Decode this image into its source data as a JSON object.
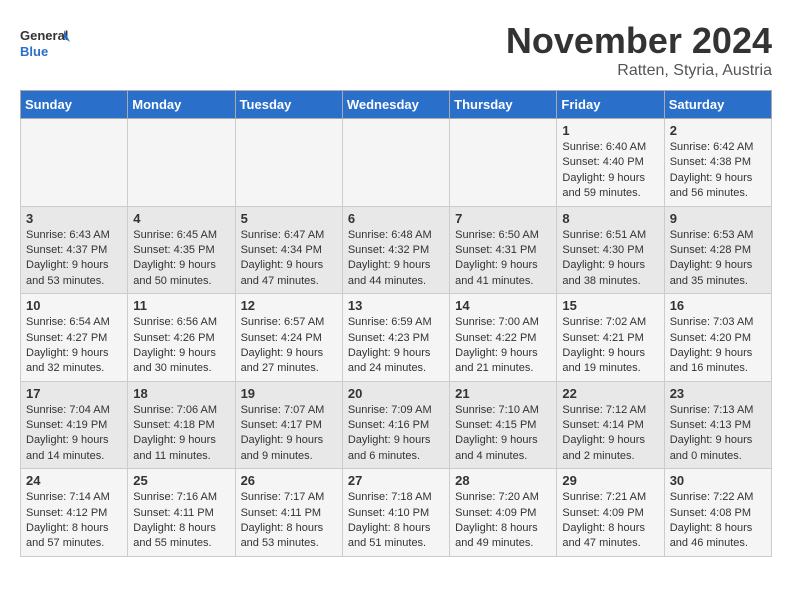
{
  "header": {
    "logo_line1": "General",
    "logo_line2": "Blue",
    "month": "November 2024",
    "location": "Ratten, Styria, Austria"
  },
  "weekdays": [
    "Sunday",
    "Monday",
    "Tuesday",
    "Wednesday",
    "Thursday",
    "Friday",
    "Saturday"
  ],
  "weeks": [
    [
      {
        "day": "",
        "info": ""
      },
      {
        "day": "",
        "info": ""
      },
      {
        "day": "",
        "info": ""
      },
      {
        "day": "",
        "info": ""
      },
      {
        "day": "",
        "info": ""
      },
      {
        "day": "1",
        "info": "Sunrise: 6:40 AM\nSunset: 4:40 PM\nDaylight: 9 hours and 59 minutes."
      },
      {
        "day": "2",
        "info": "Sunrise: 6:42 AM\nSunset: 4:38 PM\nDaylight: 9 hours and 56 minutes."
      }
    ],
    [
      {
        "day": "3",
        "info": "Sunrise: 6:43 AM\nSunset: 4:37 PM\nDaylight: 9 hours and 53 minutes."
      },
      {
        "day": "4",
        "info": "Sunrise: 6:45 AM\nSunset: 4:35 PM\nDaylight: 9 hours and 50 minutes."
      },
      {
        "day": "5",
        "info": "Sunrise: 6:47 AM\nSunset: 4:34 PM\nDaylight: 9 hours and 47 minutes."
      },
      {
        "day": "6",
        "info": "Sunrise: 6:48 AM\nSunset: 4:32 PM\nDaylight: 9 hours and 44 minutes."
      },
      {
        "day": "7",
        "info": "Sunrise: 6:50 AM\nSunset: 4:31 PM\nDaylight: 9 hours and 41 minutes."
      },
      {
        "day": "8",
        "info": "Sunrise: 6:51 AM\nSunset: 4:30 PM\nDaylight: 9 hours and 38 minutes."
      },
      {
        "day": "9",
        "info": "Sunrise: 6:53 AM\nSunset: 4:28 PM\nDaylight: 9 hours and 35 minutes."
      }
    ],
    [
      {
        "day": "10",
        "info": "Sunrise: 6:54 AM\nSunset: 4:27 PM\nDaylight: 9 hours and 32 minutes."
      },
      {
        "day": "11",
        "info": "Sunrise: 6:56 AM\nSunset: 4:26 PM\nDaylight: 9 hours and 30 minutes."
      },
      {
        "day": "12",
        "info": "Sunrise: 6:57 AM\nSunset: 4:24 PM\nDaylight: 9 hours and 27 minutes."
      },
      {
        "day": "13",
        "info": "Sunrise: 6:59 AM\nSunset: 4:23 PM\nDaylight: 9 hours and 24 minutes."
      },
      {
        "day": "14",
        "info": "Sunrise: 7:00 AM\nSunset: 4:22 PM\nDaylight: 9 hours and 21 minutes."
      },
      {
        "day": "15",
        "info": "Sunrise: 7:02 AM\nSunset: 4:21 PM\nDaylight: 9 hours and 19 minutes."
      },
      {
        "day": "16",
        "info": "Sunrise: 7:03 AM\nSunset: 4:20 PM\nDaylight: 9 hours and 16 minutes."
      }
    ],
    [
      {
        "day": "17",
        "info": "Sunrise: 7:04 AM\nSunset: 4:19 PM\nDaylight: 9 hours and 14 minutes."
      },
      {
        "day": "18",
        "info": "Sunrise: 7:06 AM\nSunset: 4:18 PM\nDaylight: 9 hours and 11 minutes."
      },
      {
        "day": "19",
        "info": "Sunrise: 7:07 AM\nSunset: 4:17 PM\nDaylight: 9 hours and 9 minutes."
      },
      {
        "day": "20",
        "info": "Sunrise: 7:09 AM\nSunset: 4:16 PM\nDaylight: 9 hours and 6 minutes."
      },
      {
        "day": "21",
        "info": "Sunrise: 7:10 AM\nSunset: 4:15 PM\nDaylight: 9 hours and 4 minutes."
      },
      {
        "day": "22",
        "info": "Sunrise: 7:12 AM\nSunset: 4:14 PM\nDaylight: 9 hours and 2 minutes."
      },
      {
        "day": "23",
        "info": "Sunrise: 7:13 AM\nSunset: 4:13 PM\nDaylight: 9 hours and 0 minutes."
      }
    ],
    [
      {
        "day": "24",
        "info": "Sunrise: 7:14 AM\nSunset: 4:12 PM\nDaylight: 8 hours and 57 minutes."
      },
      {
        "day": "25",
        "info": "Sunrise: 7:16 AM\nSunset: 4:11 PM\nDaylight: 8 hours and 55 minutes."
      },
      {
        "day": "26",
        "info": "Sunrise: 7:17 AM\nSunset: 4:11 PM\nDaylight: 8 hours and 53 minutes."
      },
      {
        "day": "27",
        "info": "Sunrise: 7:18 AM\nSunset: 4:10 PM\nDaylight: 8 hours and 51 minutes."
      },
      {
        "day": "28",
        "info": "Sunrise: 7:20 AM\nSunset: 4:09 PM\nDaylight: 8 hours and 49 minutes."
      },
      {
        "day": "29",
        "info": "Sunrise: 7:21 AM\nSunset: 4:09 PM\nDaylight: 8 hours and 47 minutes."
      },
      {
        "day": "30",
        "info": "Sunrise: 7:22 AM\nSunset: 4:08 PM\nDaylight: 8 hours and 46 minutes."
      }
    ]
  ]
}
